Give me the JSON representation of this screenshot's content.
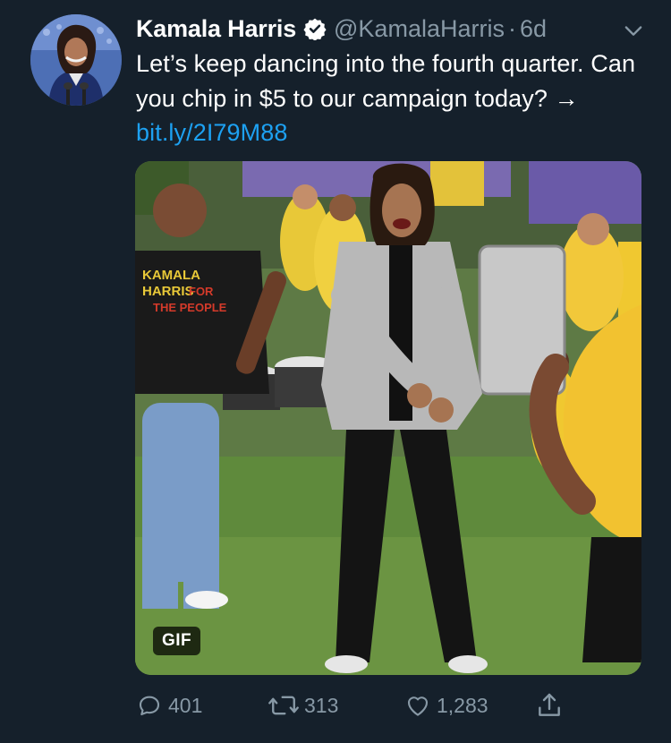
{
  "tweet": {
    "author_name": "Kamala Harris",
    "handle": "@KamalaHarris",
    "separator": "·",
    "time": "6d",
    "text_main": "Let’s keep dancing into the fourth quarter. Can you chip in $5 to our campaign today? → ",
    "link_text": "bit.ly/2I79M88",
    "media_badge": "GIF",
    "signs": {
      "shirt_line1": "KAMALA",
      "shirt_line2": "HARRIS",
      "shirt_line3": "FOR",
      "shirt_line4": "THE PEOPLE"
    }
  },
  "actions": {
    "reply_count": "401",
    "retweet_count": "313",
    "like_count": "1,283"
  },
  "icons": {
    "verified": "verified-badge-icon",
    "caret": "chevron-down-icon",
    "reply": "reply-bubble-icon",
    "retweet": "retweet-icon",
    "like": "heart-icon",
    "share": "share-icon"
  },
  "colors": {
    "background": "#15202b",
    "text": "#ffffff",
    "secondary": "#8899a6",
    "link": "#1da1f2"
  }
}
